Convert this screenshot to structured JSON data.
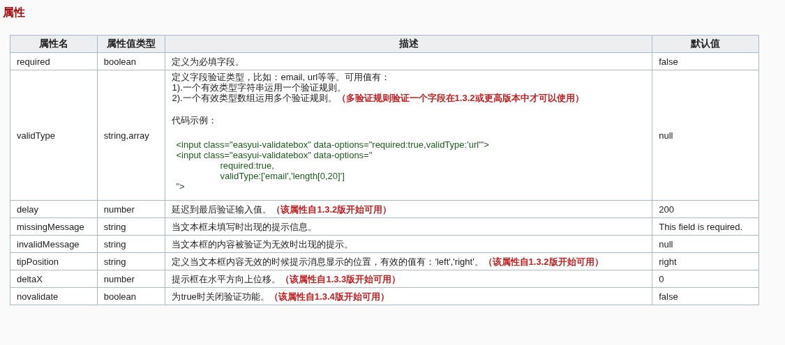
{
  "heading": "属性",
  "table": {
    "columns": [
      "属性名",
      "属性值类型",
      "描述",
      "默认值"
    ],
    "rows": [
      {
        "name": "required",
        "type": "boolean",
        "description": [
          "定义为必填字段。"
        ],
        "default": "false"
      },
      {
        "name": "validType",
        "type": "string,array",
        "description": [
          "定义字段验证类型，比如：email, url等等。可用值有：",
          "1).一个有效类型字符串运用一个验证规则。",
          "2).一个有效类型数组运用多个验证规则。**（多验证规则验证一个字段在1.3.2或更高版本中才可以使用）**"
        ],
        "example_label": "代码示例：",
        "code": [
          {
            "text": "<input class=\"easyui-validatebox\" data-options=\"required:true,validType:'url'\">",
            "indent": false
          },
          {
            "text": "<input class=\"easyui-validatebox\" data-options=\"",
            "indent": false
          },
          {
            "text": "required:true,",
            "indent": true
          },
          {
            "text": "validType:['email','length[0,20]']",
            "indent": true
          },
          {
            "text": "\">",
            "indent": false
          }
        ],
        "default": "null"
      },
      {
        "name": "delay",
        "type": "number",
        "description": [
          "延迟到最后验证输入值。**（该属性自1.3.2版开始可用）**"
        ],
        "default": "200"
      },
      {
        "name": "missingMessage",
        "type": "string",
        "description": [
          "当文本框未填写时出现的提示信息。"
        ],
        "default": "This field is required."
      },
      {
        "name": "invalidMessage",
        "type": "string",
        "description": [
          "当文本框的内容被验证为无效时出现的提示。"
        ],
        "default": "null"
      },
      {
        "name": "tipPosition",
        "type": "string",
        "description": [
          "定义当文本框内容无效的时候提示消息显示的位置，有效的值有：'left','right'。**（该属性自1.3.2版开始可用）**"
        ],
        "default": "right"
      },
      {
        "name": "deltaX",
        "type": "number",
        "description": [
          "提示框在水平方向上位移。**（该属性自1.3.3版开始可用）**"
        ],
        "default": "0"
      },
      {
        "name": "novalidate",
        "type": "boolean",
        "description": [
          "为true时关闭验证功能。**（该属性自1.3.4版开始可用）**"
        ],
        "default": "false"
      }
    ]
  }
}
